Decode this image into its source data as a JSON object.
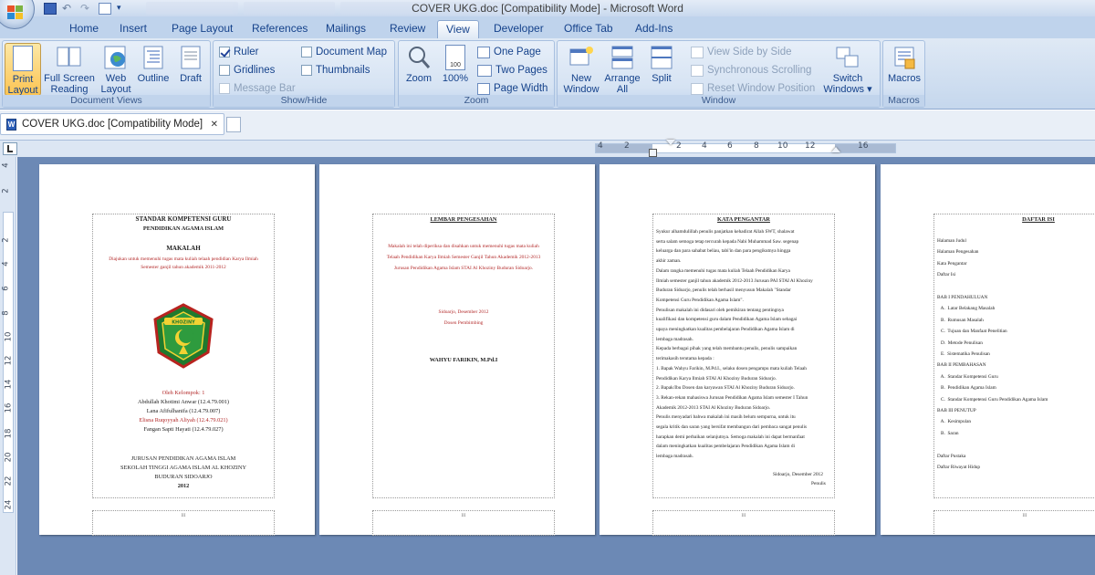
{
  "window": {
    "title": "COVER UKG.doc [Compatibility Mode] - Microsoft Word"
  },
  "tabs": [
    "Home",
    "Insert",
    "Page Layout",
    "References",
    "Mailings",
    "Review",
    "View",
    "Developer",
    "Office Tab",
    "Add-Ins"
  ],
  "active_tab": "View",
  "groups": {
    "document_views": {
      "name": "Document Views",
      "print_layout": "Print\nLayout",
      "full_screen": "Full Screen\nReading",
      "web_layout": "Web\nLayout",
      "outline": "Outline",
      "draft": "Draft"
    },
    "show_hide": {
      "name": "Show/Hide",
      "ruler": "Ruler",
      "ruler_checked": true,
      "gridlines": "Gridlines",
      "gridlines_checked": false,
      "message_bar": "Message Bar",
      "document_map": "Document Map",
      "thumbnails": "Thumbnails"
    },
    "zoom": {
      "name": "Zoom",
      "zoom": "Zoom",
      "zoom_100": "100%",
      "one_page": "One Page",
      "two_pages": "Two Pages",
      "page_width": "Page Width",
      "icon_100": "100"
    },
    "window": {
      "name": "Window",
      "new_window": "New\nWindow",
      "arrange_all": "Arrange\nAll",
      "split": "Split",
      "side_by_side": "View Side by Side",
      "sync_scroll": "Synchronous Scrolling",
      "reset_position": "Reset Window Position",
      "switch_windows": "Switch\nWindows ▾"
    },
    "macros": {
      "name": "Macros",
      "macros": "Macros"
    }
  },
  "doc_tab": {
    "label": "COVER UKG.doc [Compatibility Mode]",
    "close": "✕"
  },
  "ruler": {
    "h_ticks": [
      "4",
      "2",
      "",
      "2",
      "4",
      "6",
      "8",
      "10",
      "12",
      "",
      "16"
    ],
    "v_ticks": [
      "4",
      "2",
      "",
      "2",
      "4",
      "6",
      "8",
      "10",
      "12",
      "14",
      "16",
      "18",
      "20",
      "22",
      "24"
    ]
  },
  "pages": {
    "p1": {
      "title1": "STANDAR KOMPETENSI GURU",
      "title2": "PENDIDIKAN AGAMA ISLAM",
      "makalah": "MAKALAH",
      "sub1": "Diajukan untuk memenuhi tugas mata kuliah telaah pendidian Karya Ilmiah",
      "sub2": "Semester ganjil tahun akademik 2011-2012",
      "seal_label": "KHOZINY",
      "oleh": "Oleh Kelompok: 1",
      "m1": "Abdullah Khotimi Anwar (12.4.79.001)",
      "m2": "Lana Afifulhanifa (12.4.79.007)",
      "m3": "Elisna Ruqoyyah Aliyah (12.4.79.021)",
      "m4": "Fangan Sapti Hayati (12.4.79.027)",
      "f1": "JURUSAN PENDIDIKAN AGAMA ISLAM",
      "f2": "SEKOLAH TINGGI AGAMA ISLAM AL KHOZINY",
      "f3": "BUDURAN SIDOARJO",
      "f4": "2012"
    },
    "p2": {
      "title": "LEMBAR PENGESAHAN",
      "l1": "Makalah ini telah diperiksa dan disahkan untuk memenuhi tugas mata kuliah",
      "l2": "Telaah Pendidikan Karya Ilmiah Semester Ganjil Tahun Akademik 2012-2013",
      "l3": "Jurusan Pendidikan Agama Islam STAI Al Khoziny Buduran Sidoarjo.",
      "place": "Sidoarjo,          Desember 2012",
      "role": "Dosen Pembimbing",
      "name": "WAHYU FARIKIN, M.Pd.I"
    },
    "p3": {
      "title": "KATA PENGANTAR",
      "lines": [
        "Syukur alhamdulillah penulis panjatkan kehadirat Allah SWT, shalawat",
        "serta salam semoga tetap tercurah kepada Nabi Muhammad Saw. segenap",
        "keluarga dan para sahabat beliau, tabi'in dan para pengikutnya hingga",
        "akhir zaman.",
        "Dalam rangka memenuhi tugas mata kuliah Telaah Pendidikan Karya",
        "Ilmiah semester ganjil tahun akademik 2012-2013 Jurusan PAI STAI Al Khoziny",
        "Buduran Sidoarjo, penulis telah berhasil menyusun Makalah \"Standar",
        "Kompetensi Guru Pendidikan Agama Islam\".",
        "Penulisan makalah ini didasari oleh pemikiran tentang pentingnya",
        "kualifikasi dan kompetensi guru dalam Pendidikan Agama Islam sebagai",
        "upaya meningkatkan kualitas pembelajaran Pendidikan Agama Islam di",
        "lembaga madrasah.",
        "Kepada berbagai pihak yang telah membantu penulis, penulis sampaikan",
        "terimakasih terutama kepada :",
        "1.  Bapak Wahyu Farikin, M.Pd.I., selaku dosen pengampu mata kuliah Telaah",
        "     Pendidikan Karya Ilmiah STAI Al Khoziny Buduran Sidoarjo.",
        "2.  Bapak/Ibu Dosen dan karyawan STAI Al Khoziny Buduran Sidoarjo.",
        "3.  Rekan-rekan mahasiswa Jurusan Pendidikan Agama Islam semester I Tahun",
        "     Akademik 2012-2013 STAI Al Khoziny Buduran Sidoarjo.",
        "Penulis menyadari bahwa makalah ini masih belum sempurna, untuk itu",
        "segala kritik dan saran yang bersifat membangun dari pembaca sangat penulis",
        "harapkan demi perbaikan selanjutnya. Semoga makalah ini dapat bermanfaat",
        "dalam meningkatkan kualitas pembelajaran Pendidikan Agama Islam di",
        "lembaga madrasah."
      ],
      "date": "Sidoarjo,       Desember 2012",
      "author": "Penulis"
    },
    "p4": {
      "title": "DAFTAR ISI",
      "lines": [
        "Halaman Judul",
        "Halaman Pengesahan",
        "Kata Pengantar",
        "Daftar Isi",
        "",
        "BAB I PENDAHULUAN",
        "   A.  Latar Belakang Masalah",
        "   B.  Rumusan Masalah",
        "   C.  Tujuan dan Manfaat Penelitian",
        "   D.  Metode Penulisan",
        "   E.  Sistematika Penulisan",
        "BAB II PEMBAHASAN",
        "   A.  Standar Kompetensi Guru",
        "   B.  Pendidikan Agama Islam",
        "   C.  Standar Kompetensi Guru Pendidikan Agama Islam",
        "BAB III PENUTUP",
        "   A.  Kesimpulan",
        "   B.  Saran",
        "",
        "Daftar Pustaka",
        "Daftar Riwayat Hidup"
      ]
    },
    "footer_mark": "III"
  },
  "colors": {
    "ribbon_bg": "#dfe9f5",
    "workspace_bg": "#6c89b5",
    "accent": "#15428b",
    "pressed": "#fbc453",
    "red_text": "#b32a2a"
  }
}
